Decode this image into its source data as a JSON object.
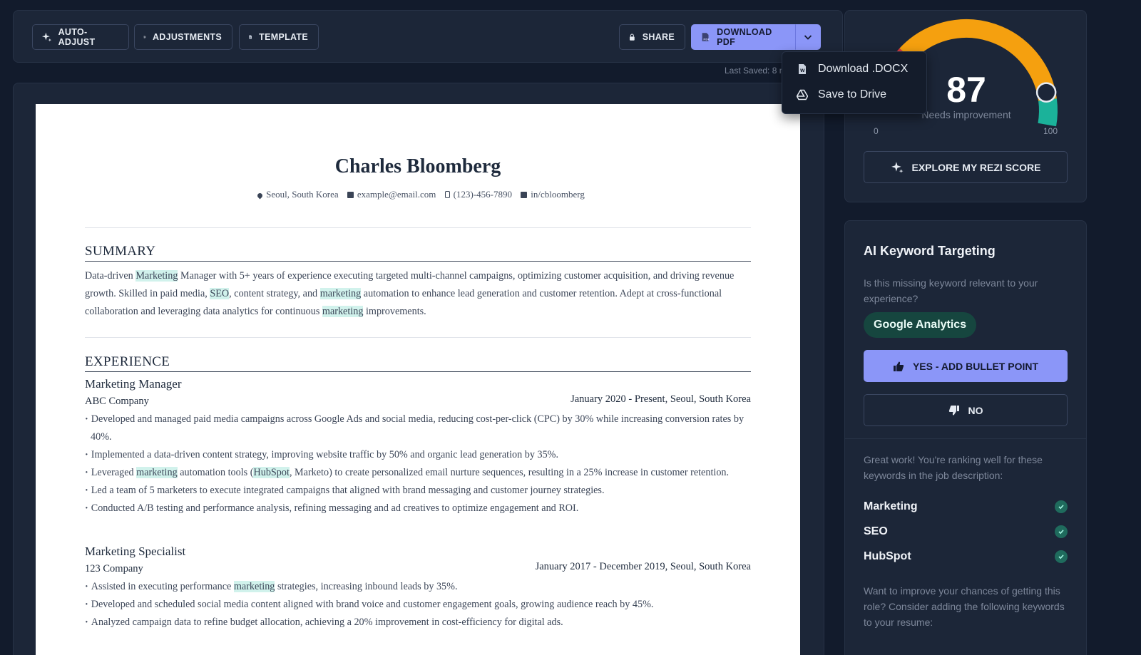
{
  "toolbar": {
    "auto_adjust": "AUTO-ADJUST",
    "adjustments": "ADJUSTMENTS",
    "template": "TEMPLATE",
    "share": "SHARE",
    "download_pdf": "DOWNLOAD PDF",
    "last_saved": "Last Saved: 8 m"
  },
  "download_menu": {
    "items": [
      {
        "label": "Download .DOCX",
        "icon": "docx-file-icon"
      },
      {
        "label": "Save to Drive",
        "icon": "google-drive-icon"
      }
    ]
  },
  "resume": {
    "name": "Charles Bloomberg",
    "contact": {
      "location": "Seoul,  South Korea",
      "email": "example@email.com",
      "phone": "(123)-456-7890",
      "linkedin": "in/cbloomberg"
    },
    "summary_title": "SUMMARY",
    "summary_parts": [
      "Data-driven ",
      "Marketing",
      " Manager with 5+ years of experience executing targeted multi-channel campaigns, optimizing customer acquisition, and driving revenue growth. Skilled in paid media, ",
      "SEO",
      ", content strategy, and ",
      "marketing",
      " automation to enhance lead generation and customer retention. Adept at cross-functional collaboration and leveraging data analytics for continuous ",
      "marketing",
      " improvements."
    ],
    "experience_title": "EXPERIENCE",
    "jobs": [
      {
        "title": "Marketing Manager",
        "company": "ABC Company",
        "dates": "January 2020  - Present,  Seoul, South Korea",
        "bullets": [
          "Developed and managed paid media campaigns across Google Ads and social media, reducing cost-per-click (CPC) by 30% while increasing conversion rates by 40%.",
          "Implemented a data-driven content strategy, improving website traffic by 50% and organic lead generation by 35%.",
          "Leveraged |marketing| automation tools (|HubSpot|, Marketo) to create personalized email nurture sequences, resulting in a 25% increase in customer retention.",
          "Led a team of 5 marketers to execute integrated campaigns that aligned with brand messaging and customer journey strategies.",
          "Conducted A/B testing and performance analysis, refining messaging and ad creatives to optimize engagement and ROI."
        ]
      },
      {
        "title": "Marketing Specialist",
        "company": "123 Company",
        "dates": "January 2017  - December 2019,  Seoul, South Korea",
        "bullets": [
          "Assisted in executing performance |marketing| strategies, increasing inbound leads by 35%.",
          "Developed and scheduled social media content aligned with brand voice and customer engagement goals, growing audience reach by 45%.",
          "Analyzed campaign data to refine budget allocation, achieving a 20% improvement in cost-efficiency for digital ads."
        ]
      }
    ]
  },
  "score": {
    "value": "87",
    "status": "Needs improvement",
    "min": "0",
    "max": "100",
    "fraction": 0.87,
    "colors": {
      "red": "#d9393f",
      "orange": "#f5a00f",
      "teal": "#1bb29a"
    },
    "explore_label": "EXPLORE MY REZI SCORE"
  },
  "keywords": {
    "title": "AI Keyword Targeting",
    "question": "Is this missing keyword relevant to your experience?",
    "missing_keyword": "Google Analytics",
    "yes_label": "YES - ADD BULLET POINT",
    "no_label": "NO",
    "good_text": "Great work! You're ranking well for these keywords in the job description:",
    "matched": [
      "Marketing",
      "SEO",
      "HubSpot"
    ],
    "improve_text": "Want to improve your chances of getting this role? Consider adding the following keywords to your resume:"
  },
  "colors": {
    "background": "#121b2c",
    "panel": "#1c2638",
    "accent": "#8b96f8",
    "highlight": "#d1f2ec",
    "chip": "#16463f"
  }
}
